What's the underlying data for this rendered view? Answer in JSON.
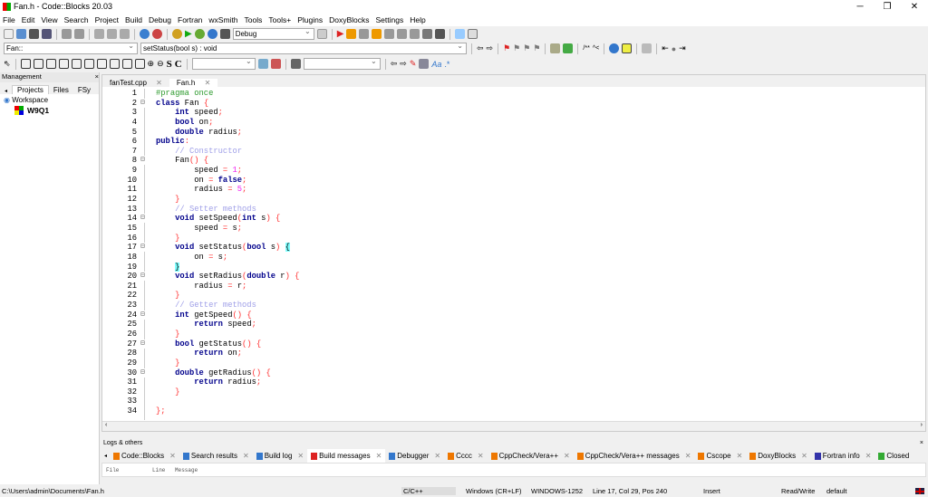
{
  "window": {
    "title": "Fan.h - Code::Blocks 20.03"
  },
  "menu": [
    "File",
    "Edit",
    "View",
    "Search",
    "Project",
    "Build",
    "Debug",
    "Fortran",
    "wxSmith",
    "Tools",
    "Tools+",
    "Plugins",
    "DoxyBlocks",
    "Settings",
    "Help"
  ],
  "toolbar": {
    "build_target": "Debug",
    "scope": "Fan::",
    "function": "setStatus(bool s) : void",
    "search_value": "",
    "find_value": ""
  },
  "management": {
    "title": "Management",
    "tabs": [
      "Projects",
      "Files",
      "FSy"
    ],
    "workspace": "Workspace",
    "project": "W9Q1"
  },
  "editor": {
    "tabs": [
      "fanTest.cpp",
      "Fan.h"
    ],
    "active_tab": 1,
    "lines": [
      [
        [
          "pp",
          "#pragma once"
        ]
      ],
      [
        [
          "kw",
          "class"
        ],
        [
          "id",
          " Fan "
        ],
        [
          "op",
          "{"
        ]
      ],
      [
        [
          "id",
          "    "
        ],
        [
          "kw",
          "int"
        ],
        [
          "id",
          " speed"
        ],
        [
          "op",
          ";"
        ]
      ],
      [
        [
          "id",
          "    "
        ],
        [
          "kw",
          "bool"
        ],
        [
          "id",
          " on"
        ],
        [
          "op",
          ";"
        ]
      ],
      [
        [
          "id",
          "    "
        ],
        [
          "kw",
          "double"
        ],
        [
          "id",
          " radius"
        ],
        [
          "op",
          ";"
        ]
      ],
      [
        [
          "kw",
          "public"
        ],
        [
          "op",
          ":"
        ]
      ],
      [
        [
          "id",
          "    "
        ],
        [
          "cm",
          "// Constructor"
        ]
      ],
      [
        [
          "id",
          "    Fan"
        ],
        [
          "op",
          "() {"
        ]
      ],
      [
        [
          "id",
          "        speed "
        ],
        [
          "op",
          "="
        ],
        [
          "id",
          " "
        ],
        [
          "nm",
          "1"
        ],
        [
          "op",
          ";"
        ]
      ],
      [
        [
          "id",
          "        on "
        ],
        [
          "op",
          "="
        ],
        [
          "id",
          " "
        ],
        [
          "kw",
          "false"
        ],
        [
          "op",
          ";"
        ]
      ],
      [
        [
          "id",
          "        radius "
        ],
        [
          "op",
          "="
        ],
        [
          "id",
          " "
        ],
        [
          "nm",
          "5"
        ],
        [
          "op",
          ";"
        ]
      ],
      [
        [
          "id",
          "    "
        ],
        [
          "op",
          "}"
        ]
      ],
      [
        [
          "id",
          "    "
        ],
        [
          "cm",
          "// Setter methods"
        ]
      ],
      [
        [
          "id",
          "    "
        ],
        [
          "kw",
          "void"
        ],
        [
          "id",
          " setSpeed"
        ],
        [
          "op",
          "("
        ],
        [
          "kw",
          "int"
        ],
        [
          "id",
          " s"
        ],
        [
          "op",
          ") {"
        ]
      ],
      [
        [
          "id",
          "        speed "
        ],
        [
          "op",
          "="
        ],
        [
          "id",
          " s"
        ],
        [
          "op",
          ";"
        ]
      ],
      [
        [
          "id",
          "    "
        ],
        [
          "op",
          "}"
        ]
      ],
      [
        [
          "id",
          "    "
        ],
        [
          "kw",
          "void"
        ],
        [
          "id",
          " setStatus"
        ],
        [
          "op",
          "("
        ],
        [
          "kw",
          "bool"
        ],
        [
          "id",
          " s"
        ],
        [
          "op",
          ") "
        ],
        [
          "br",
          "{"
        ]
      ],
      [
        [
          "id",
          "        on "
        ],
        [
          "op",
          "="
        ],
        [
          "id",
          " s"
        ],
        [
          "op",
          ";"
        ]
      ],
      [
        [
          "id",
          "    "
        ],
        [
          "br",
          "}"
        ]
      ],
      [
        [
          "id",
          "    "
        ],
        [
          "kw",
          "void"
        ],
        [
          "id",
          " setRadius"
        ],
        [
          "op",
          "("
        ],
        [
          "kw",
          "double"
        ],
        [
          "id",
          " r"
        ],
        [
          "op",
          ") {"
        ]
      ],
      [
        [
          "id",
          "        radius "
        ],
        [
          "op",
          "="
        ],
        [
          "id",
          " r"
        ],
        [
          "op",
          ";"
        ]
      ],
      [
        [
          "id",
          "    "
        ],
        [
          "op",
          "}"
        ]
      ],
      [
        [
          "id",
          "    "
        ],
        [
          "cm",
          "// Getter methods"
        ]
      ],
      [
        [
          "id",
          "    "
        ],
        [
          "kw",
          "int"
        ],
        [
          "id",
          " getSpeed"
        ],
        [
          "op",
          "() {"
        ]
      ],
      [
        [
          "id",
          "        "
        ],
        [
          "kw",
          "return"
        ],
        [
          "id",
          " speed"
        ],
        [
          "op",
          ";"
        ]
      ],
      [
        [
          "id",
          "    "
        ],
        [
          "op",
          "}"
        ]
      ],
      [
        [
          "id",
          "    "
        ],
        [
          "kw",
          "bool"
        ],
        [
          "id",
          " getStatus"
        ],
        [
          "op",
          "() {"
        ]
      ],
      [
        [
          "id",
          "        "
        ],
        [
          "kw",
          "return"
        ],
        [
          "id",
          " on"
        ],
        [
          "op",
          ";"
        ]
      ],
      [
        [
          "id",
          "    "
        ],
        [
          "op",
          "}"
        ]
      ],
      [
        [
          "id",
          "    "
        ],
        [
          "kw",
          "double"
        ],
        [
          "id",
          " getRadius"
        ],
        [
          "op",
          "() {"
        ]
      ],
      [
        [
          "id",
          "        "
        ],
        [
          "kw",
          "return"
        ],
        [
          "id",
          " radius"
        ],
        [
          "op",
          ";"
        ]
      ],
      [
        [
          "id",
          "    "
        ],
        [
          "op",
          "}"
        ]
      ],
      [],
      [
        [
          "op",
          "};"
        ]
      ]
    ]
  },
  "logs": {
    "title": "Logs & others",
    "tabs": [
      "Code::Blocks",
      "Search results",
      "Build log",
      "Build messages",
      "Debugger",
      "Cccc",
      "CppCheck/Vera++",
      "CppCheck/Vera++ messages",
      "Cscope",
      "DoxyBlocks",
      "Fortran info",
      "Closed"
    ],
    "active_tab": 3,
    "columns": [
      "File",
      "Line",
      "Message"
    ]
  },
  "status": {
    "path": "C:\\Users\\admin\\Documents\\Fan.h",
    "language": "C/C++",
    "eol": "Windows (CR+LF)",
    "encoding": "WINDOWS-1252",
    "position": "Line 17, Col 29, Pos 240",
    "mode": "Insert",
    "access": "Read/Write",
    "profile": "default"
  }
}
